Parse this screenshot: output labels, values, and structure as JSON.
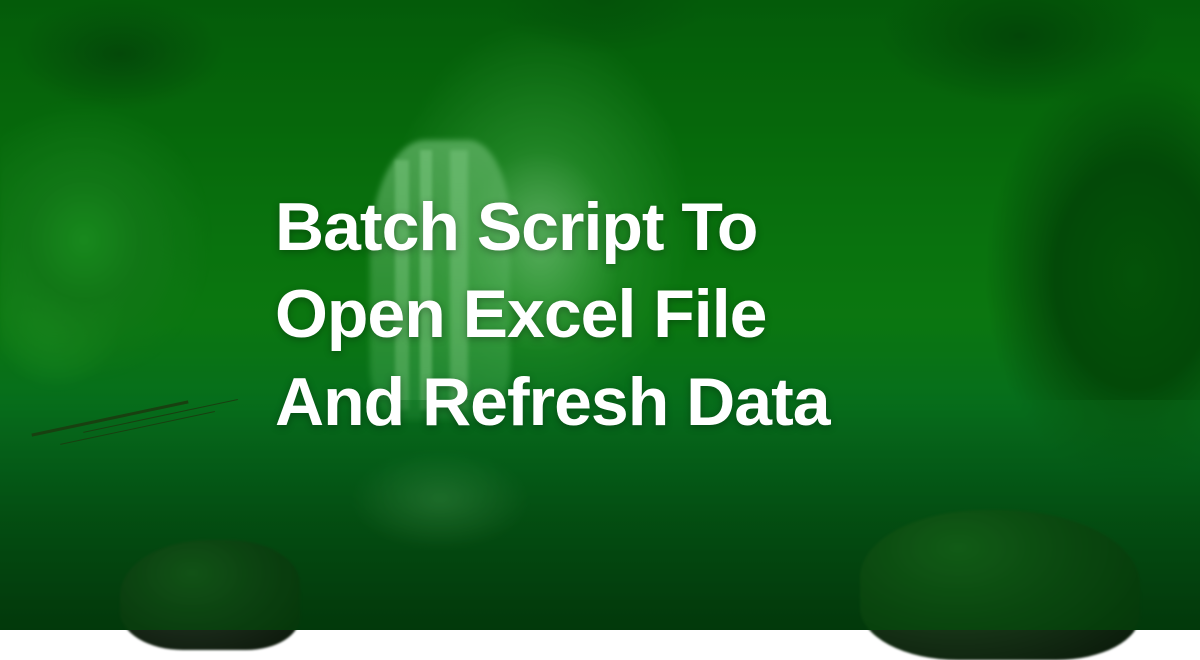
{
  "title": {
    "line1": "Batch Script To",
    "line2": "Open Excel File",
    "line3": "And Refresh Data"
  },
  "colors": {
    "overlay_green": "#009600",
    "text": "#ffffff"
  }
}
